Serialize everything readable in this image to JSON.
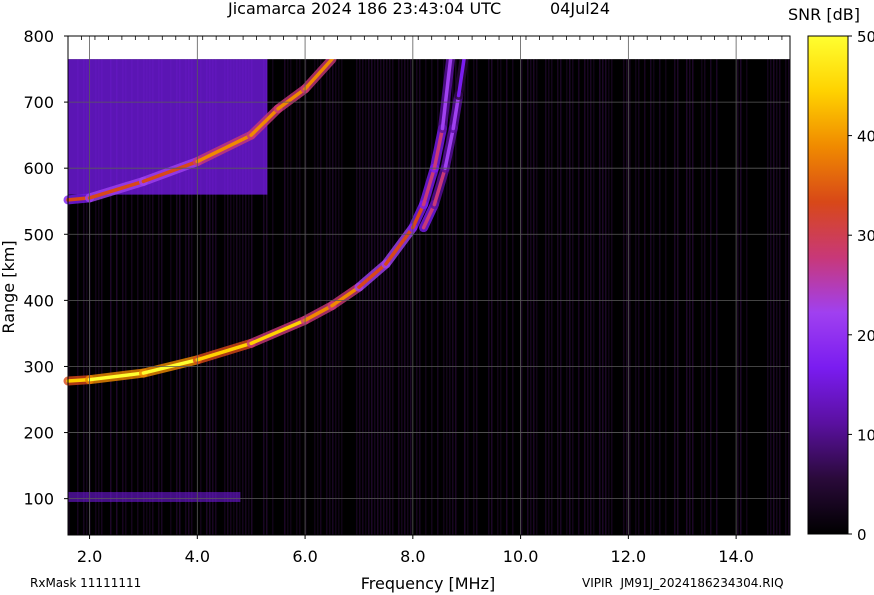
{
  "header": {
    "title": "Jicamarca 2024 186 23:43:04 UTC",
    "date": "04Jul24"
  },
  "footer": {
    "rxmask": "RxMask 11111111",
    "filename": "VIPIR  JM91J_2024186234304.RIQ"
  },
  "colors": {
    "background": "#000000",
    "grid": "#5a5a5a",
    "colormap": [
      "#000000",
      "#2a0a3a",
      "#5a10a0",
      "#7a1cf0",
      "#a040f0",
      "#c83878",
      "#d84818",
      "#f08a00",
      "#ffd200",
      "#ffff30"
    ]
  },
  "chart_data": {
    "type": "heatmap",
    "title": "Jicamarca 2024 186 23:43:04 UTC",
    "xlabel": "Frequency [MHz]",
    "ylabel": "Range [km]",
    "xlim": [
      1.6,
      15.0
    ],
    "ylim": [
      45,
      800
    ],
    "data_top_km": 765,
    "x_ticks": [
      2.0,
      4.0,
      6.0,
      8.0,
      10.0,
      12.0,
      14.0
    ],
    "x_tick_labels": [
      "2.0",
      "4.0",
      "6.0",
      "8.0",
      "10.0",
      "12.0",
      "14.0"
    ],
    "y_ticks": [
      100,
      200,
      300,
      400,
      500,
      600,
      700,
      800
    ],
    "y_tick_labels": [
      "100",
      "200",
      "300",
      "400",
      "500",
      "600",
      "700",
      "800"
    ],
    "grid": true,
    "colorbar": {
      "label": "SNR [dB]",
      "min": 0,
      "max": 50,
      "ticks": [
        0,
        10,
        20,
        30,
        40,
        50
      ],
      "tick_labels": [
        "0",
        "10",
        "20",
        "30",
        "40",
        "50"
      ]
    },
    "series": [
      {
        "trace": "F-layer O trace",
        "freq_mhz": [
          1.6,
          2.0,
          3.0,
          4.0,
          5.0,
          6.0,
          6.5,
          7.0,
          7.5,
          8.0,
          8.2,
          8.4,
          8.55,
          8.7
        ],
        "range_km": [
          278,
          280,
          290,
          310,
          335,
          370,
          392,
          420,
          455,
          510,
          545,
          600,
          660,
          765
        ],
        "peak_snr_db": [
          44,
          48,
          50,
          48,
          45,
          40,
          38,
          36,
          34,
          32,
          30,
          28,
          25,
          20
        ]
      },
      {
        "trace": "F-layer X trace",
        "freq_mhz": [
          8.2,
          8.4,
          8.6,
          8.75,
          8.85,
          8.95
        ],
        "range_km": [
          510,
          545,
          600,
          660,
          710,
          765
        ],
        "peak_snr_db": [
          28,
          26,
          24,
          22,
          20,
          18
        ]
      },
      {
        "trace": "Multi-hop trace",
        "freq_mhz": [
          1.6,
          2.0,
          3.0,
          4.0,
          5.0,
          5.5,
          6.0,
          6.5
        ],
        "range_km": [
          552,
          555,
          580,
          610,
          650,
          690,
          720,
          765
        ],
        "peak_snr_db": [
          30,
          32,
          34,
          36,
          38,
          40,
          40,
          38
        ]
      }
    ]
  }
}
